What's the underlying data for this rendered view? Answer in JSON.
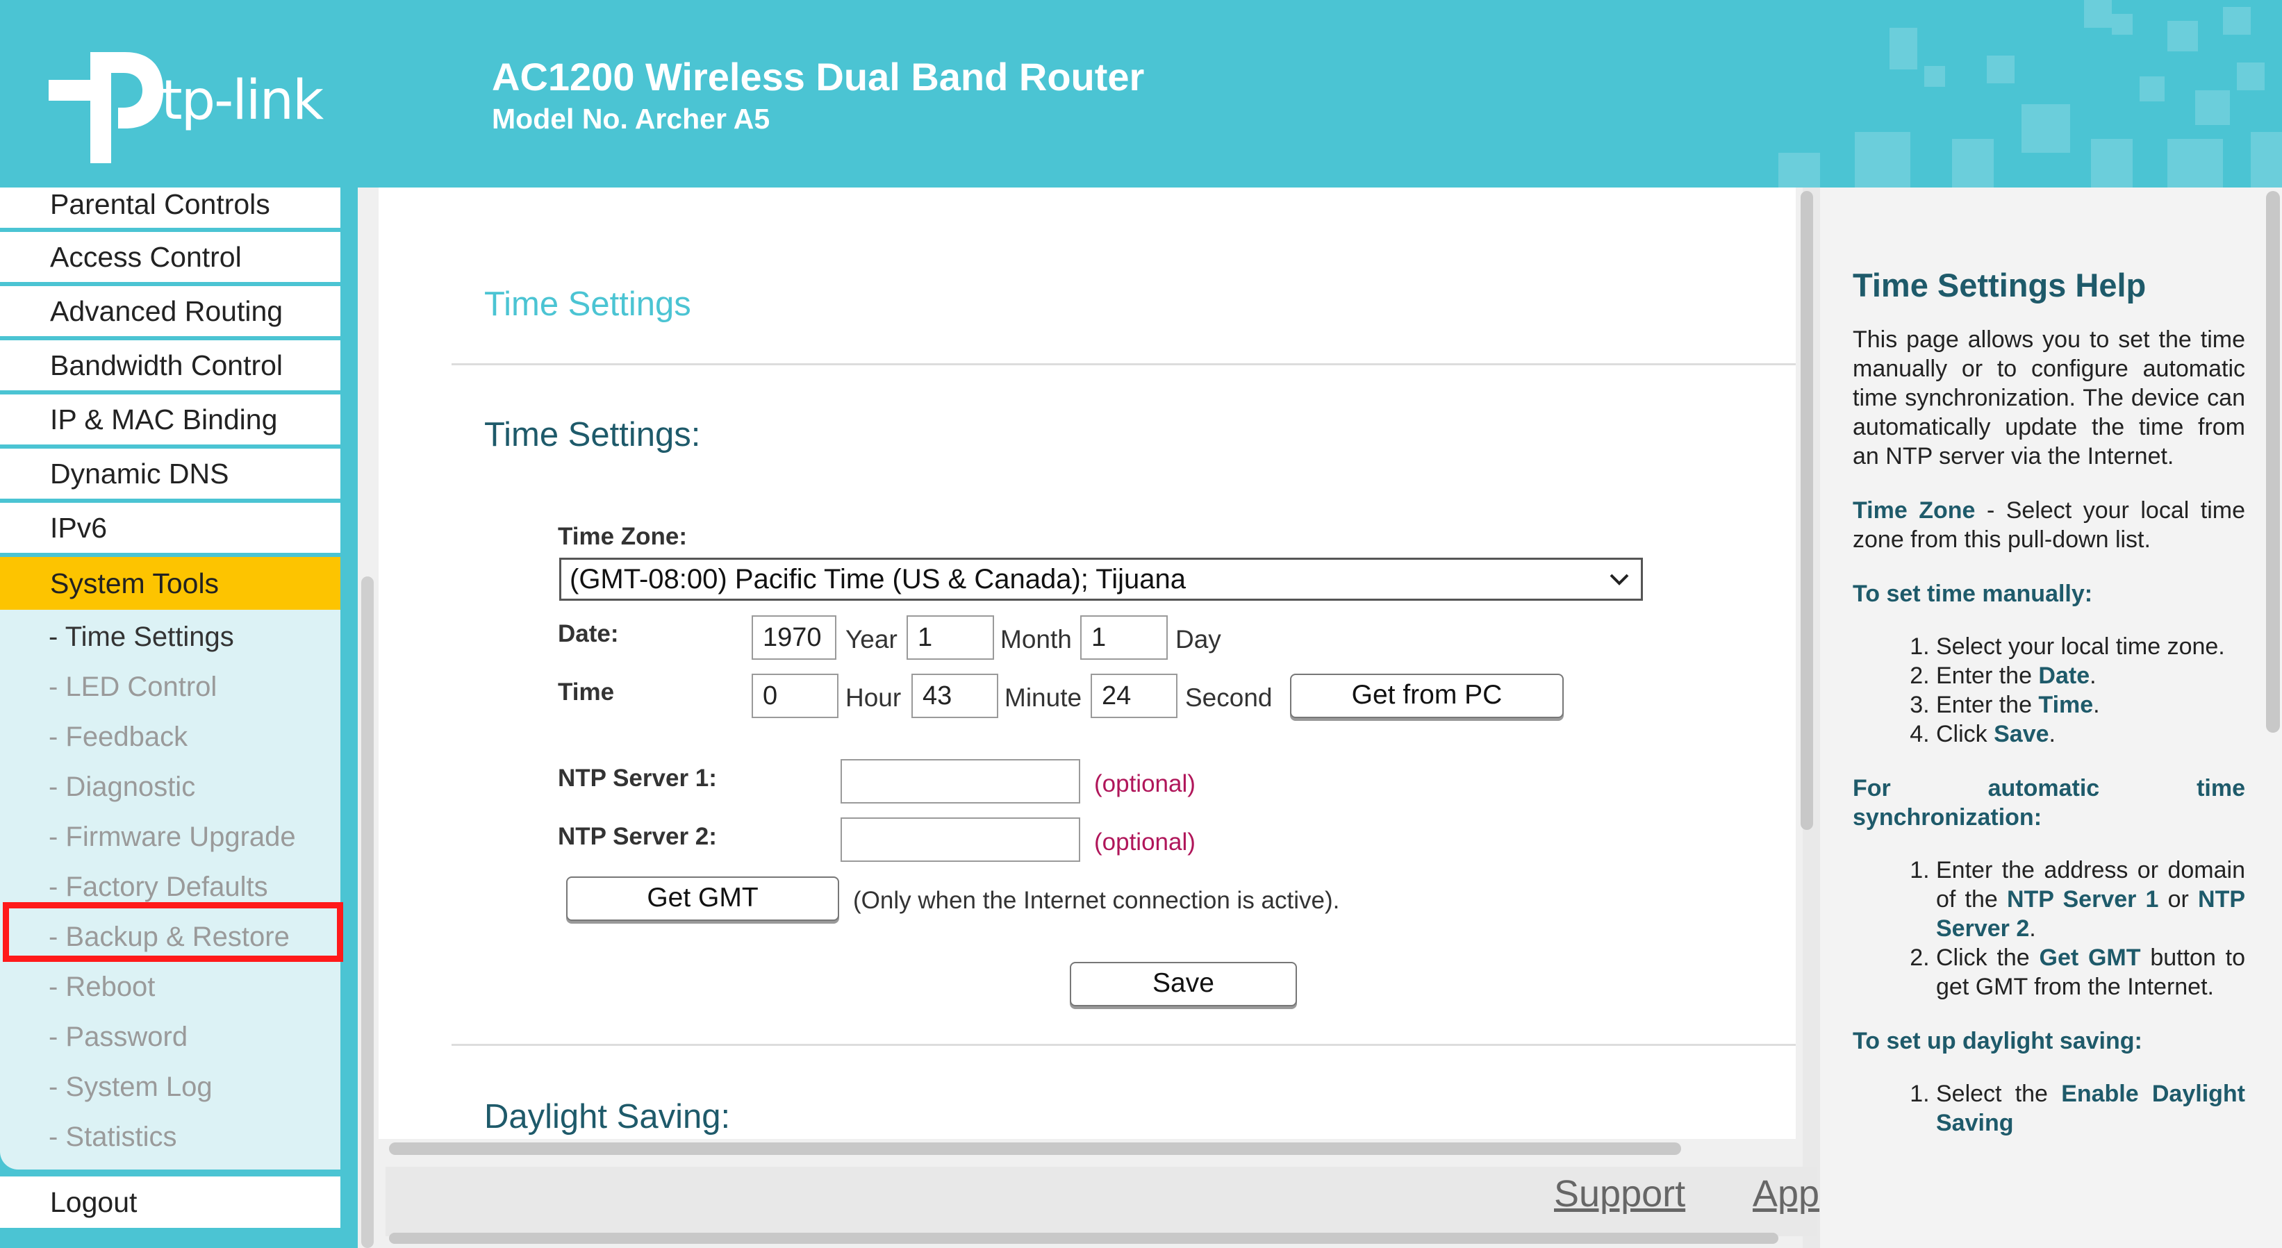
{
  "header": {
    "brand": "tp-link",
    "router_title": "AC1200 Wireless Dual Band Router",
    "model": "Model No. Archer A5"
  },
  "sidebar": {
    "items": [
      {
        "label": "Parental Controls"
      },
      {
        "label": "Access Control"
      },
      {
        "label": "Advanced Routing"
      },
      {
        "label": "Bandwidth Control"
      },
      {
        "label": "IP & MAC Binding"
      },
      {
        "label": "Dynamic DNS"
      },
      {
        "label": "IPv6"
      },
      {
        "label": "System Tools"
      }
    ],
    "subitems": [
      {
        "label": "- Time Settings"
      },
      {
        "label": "- LED Control"
      },
      {
        "label": "- Feedback"
      },
      {
        "label": "- Diagnostic"
      },
      {
        "label": "- Firmware Upgrade"
      },
      {
        "label": "- Factory Defaults"
      },
      {
        "label": "- Backup & Restore"
      },
      {
        "label": "- Reboot"
      },
      {
        "label": "- Password"
      },
      {
        "label": "- System Log"
      },
      {
        "label": "- Statistics"
      }
    ],
    "logout": "Logout"
  },
  "main": {
    "page_title": "Time Settings",
    "section_title": "Time Settings:",
    "time_zone_label": "Time Zone:",
    "time_zone_value": "(GMT-08:00) Pacific Time (US & Canada); Tijuana",
    "date_label": "Date:",
    "year_value": "1970",
    "year_unit": "Year",
    "month_value": "1",
    "month_unit": "Month",
    "day_value": "1",
    "day_unit": "Day",
    "time_label": "Time",
    "hour_value": "0",
    "hour_unit": "Hour",
    "minute_value": "43",
    "minute_unit": "Minute",
    "second_value": "24",
    "second_unit": "Second",
    "get_from_pc": "Get from PC",
    "ntp1_label": "NTP Server 1:",
    "ntp1_value": "",
    "ntp2_label": "NTP Server 2:",
    "ntp2_value": "",
    "optional": "(optional)",
    "get_gmt": "Get GMT",
    "gmt_note": "(Only when the Internet connection is active).",
    "save": "Save",
    "daylight_title": "Daylight Saving:"
  },
  "footer": {
    "support": "Support",
    "app": "App"
  },
  "help": {
    "title": "Time Settings Help",
    "intro": "This page allows you to set the time manually or to configure automatic time synchronization. The device can automatically update the time from an NTP server via the Internet.",
    "tz_term": "Time Zone",
    "tz_desc": " - Select your local time zone from this pull-down list.",
    "manual_heading": "To set time manually:",
    "manual_1": "Select your local time zone.",
    "manual_2_pre": "Enter the ",
    "manual_2_kw": "Date",
    "manual_3_pre": "Enter the ",
    "manual_3_kw": "Time",
    "manual_4_pre": "Click ",
    "manual_4_kw": "Save",
    "period": ".",
    "auto_heading": "For automatic time synchronization:",
    "auto_1_pre": "Enter the address or domain of the ",
    "auto_1_kw1": "NTP Server 1",
    "auto_1_mid": " or ",
    "auto_1_kw2": "NTP Server 2",
    "auto_2_pre": "Click the ",
    "auto_2_kw": "Get GMT",
    "auto_2_post": " button to get GMT from the Internet.",
    "daylight_heading": "To set up daylight saving:",
    "daylight_1_pre": "Select the ",
    "daylight_1_kw": "Enable Daylight Saving"
  },
  "colors": {
    "brand_teal": "#4bc4d3",
    "active_yellow": "#fdc400",
    "highlight_red": "#ff1a1a",
    "heading_dark_teal": "#1e5a6a",
    "optional_magenta": "#b0165a"
  }
}
